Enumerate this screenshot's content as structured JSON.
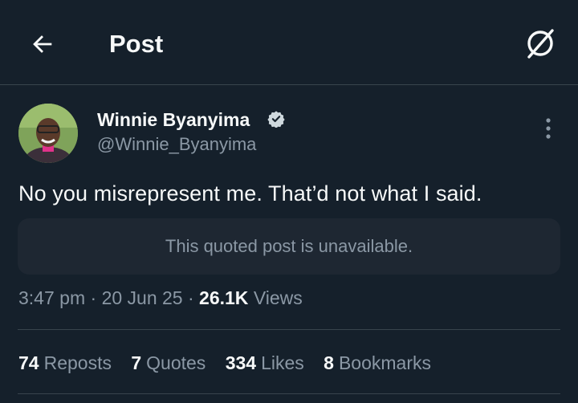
{
  "header": {
    "title": "Post"
  },
  "icons": {
    "back": "arrow-left-icon",
    "grok": "grok-icon",
    "verified": "verified-badge-icon",
    "more": "more-vertical-icon"
  },
  "colors": {
    "background": "#15202b",
    "text": "#f7f9f9",
    "muted": "#8b98a5",
    "divider": "#38444d",
    "quote_bg": "#1e2732"
  },
  "tweet": {
    "author_name": "Winnie Byanyima",
    "handle": "@Winnie_Byanyima",
    "text": "No you misrepresent me. That’d not what I said.",
    "quoted_notice": "This quoted post is unavailable.",
    "time": "3:47 pm",
    "date": "20 Jun 25",
    "views_count": "26.1K",
    "views_label": "Views"
  },
  "stats": [
    {
      "count": "74",
      "label": "Reposts"
    },
    {
      "count": "7",
      "label": "Quotes"
    },
    {
      "count": "334",
      "label": "Likes"
    },
    {
      "count": "8",
      "label": "Bookmarks"
    }
  ]
}
